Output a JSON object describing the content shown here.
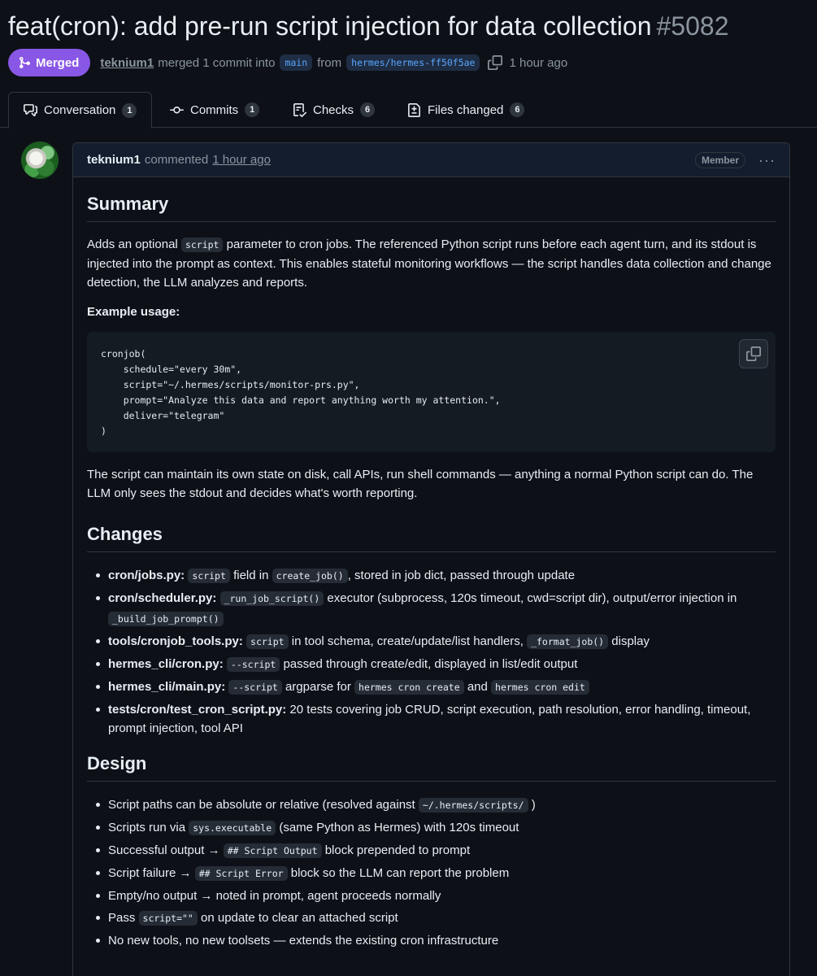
{
  "pr": {
    "title": "feat(cron): add pre-run script injection for data collection",
    "number": "#5082",
    "status": "Merged",
    "author": "teknium1",
    "merged_text": "merged 1 commit into",
    "base_branch": "main",
    "from_text": "from",
    "head_branch": "hermes/hermes-ff50f5ae",
    "time": "1 hour ago"
  },
  "tabs": [
    {
      "label": "Conversation",
      "count": "1",
      "icon": "comment-discussion-icon"
    },
    {
      "label": "Commits",
      "count": "1",
      "icon": "git-commit-icon"
    },
    {
      "label": "Checks",
      "count": "6",
      "icon": "checklist-icon"
    },
    {
      "label": "Files changed",
      "count": "6",
      "icon": "file-diff-icon"
    }
  ],
  "comment": {
    "author": "teknium1",
    "verb": "commented",
    "time": "1 hour ago",
    "badge": "Member",
    "menu": "···"
  },
  "summary": {
    "heading": "Summary",
    "p1_a": "Adds an optional",
    "p1_code": "script",
    "p1_b": "parameter to cron jobs. The referenced Python script runs before each agent turn, and its stdout is injected into the prompt as context. This enables stateful monitoring workflows — the script handles data collection and change detection, the LLM analyzes and reports.",
    "example_label": "Example usage:",
    "code": "cronjob(\n    schedule=\"every 30m\",\n    script=\"~/.hermes/scripts/monitor-prs.py\",\n    prompt=\"Analyze this data and report anything worth my attention.\",\n    deliver=\"telegram\"\n)",
    "p2": "The script can maintain its own state on disk, call APIs, run shell commands — anything a normal Python script can do. The LLM only sees the stdout and decides what's worth reporting."
  },
  "changes": {
    "heading": "Changes",
    "items": [
      {
        "file": "cron/jobs.py:",
        "c1": "script",
        "t1": "field in",
        "c2": "create_job()",
        "t2": ", stored in job dict, passed through update"
      },
      {
        "file": "cron/scheduler.py:",
        "c1": "_run_job_script()",
        "t1": "executor (subprocess, 120s timeout, cwd=script dir), output/error injection in",
        "c2": "_build_job_prompt()"
      },
      {
        "file": "tools/cronjob_tools.py:",
        "c1": "script",
        "t1": "in tool schema, create/update/list handlers,",
        "c2": "_format_job()",
        "t2": "display"
      },
      {
        "file": "hermes_cli/cron.py:",
        "c1": "--script",
        "t1": "passed through create/edit, displayed in list/edit output"
      },
      {
        "file": "hermes_cli/main.py:",
        "c1": "--script",
        "t1": "argparse for",
        "c2": "hermes cron create",
        "t2": "and",
        "c3": "hermes cron edit"
      },
      {
        "file": "tests/cron/test_cron_script.py:",
        "t1": "20 tests covering job CRUD, script execution, path resolution, error handling, timeout, prompt injection, tool API"
      }
    ]
  },
  "design": {
    "heading": "Design",
    "items": [
      {
        "t1": "Script paths can be absolute or relative (resolved against",
        "c1": "~/.hermes/scripts/",
        "t2": ")"
      },
      {
        "t1": "Scripts run via",
        "c1": "sys.executable",
        "t2": "(same Python as Hermes) with 120s timeout"
      },
      {
        "t1": "Successful output →",
        "c1": "## Script Output",
        "t2": "block prepended to prompt"
      },
      {
        "t1": "Script failure →",
        "c1": "## Script Error",
        "t2": "block so the LLM can report the problem"
      },
      {
        "t1": "Empty/no output → noted in prompt, agent proceeds normally"
      },
      {
        "t1": "Pass",
        "c1": "script=\"\"",
        "t2": "on update to clear an attached script"
      },
      {
        "t1": "No new tools, no new toolsets — extends the existing cron infrastructure"
      }
    ]
  }
}
